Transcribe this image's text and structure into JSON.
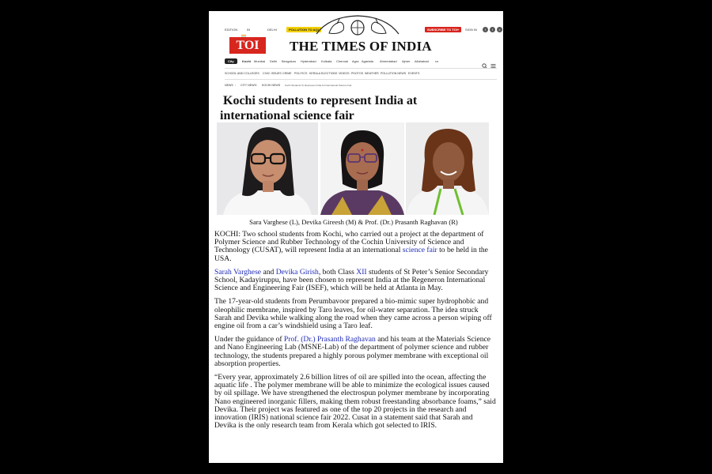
{
  "topbar": {
    "edition": "EDITION",
    "edition_code": "IN",
    "city": "DELHI",
    "pollution_button": "POLLUTION TO AQI",
    "subscribe_button": "SUBSCRIBE TO TOI+",
    "signin": "SIGN IN"
  },
  "masthead": {
    "logo": "TOI",
    "title": "THE TIMES OF INDIA"
  },
  "nav": {
    "city_pill": "City",
    "items": [
      "Kochi",
      "Mumbai",
      "Delhi",
      "Bengaluru",
      "Hyderabad",
      "Kolkata",
      "Chennai",
      "Agra",
      "Agartala",
      "Ahmedabad",
      "Ajmer",
      "Allahabad",
      "•••"
    ]
  },
  "subnav": {
    "items": [
      "SCHOOL AND COLLEGES",
      "CIVIC ISSUES",
      "CRIME",
      "POLITICS",
      "KERALA ELECTIONS",
      "VIDEOS",
      "PHOTOS",
      "WEATHER",
      "POLLUTION NEWS",
      "EVENTS"
    ]
  },
  "breadcrumb": [
    "NEWS",
    "CITY NEWS",
    "KOCHI NEWS",
    "Kochi Students To Represent India At International Science Fair"
  ],
  "article": {
    "headline_line1": "Kochi students to represent India at",
    "headline_line2": "international  science fair",
    "caption": "Sara Varghese (L), Devika Gireesh (M) & Prof. (Dr.) Prasanth Raghavan (R)",
    "p1_a": "KOCHI: Two school students from Kochi, who carried out a project at the department of Polymer Science and Rubber Technology of the Cochin University of Science and Technology (CUSAT), will represent India at an international ",
    "p1_link": "science fair",
    "p1_b": " to be held in the USA.",
    "p2_link1": "Sarah Varghese",
    "p2_and": " and ",
    "p2_link2": "Devika Girish",
    "p2_a": ", both Class ",
    "p2_link3": "XII",
    "p2_b": " students of St Peter’s Senior Secondary School, Kadayiruppu, have been chosen to represent India at the Regeneron International Science and Engineering Fair (ISEF), which will be held at Atlanta in May.",
    "p3": "The 17-year-old students from Perumbavoor prepared a bio-mimic super hydrophobic and oleophilic membrane, inspired by Taro leaves, for oil-water separation. The idea struck Sarah and Devika while walking along the road when they came across a person wiping off engine oil from a car’s windshield using a Taro leaf.",
    "p4_a": "Under the guidance of ",
    "p4_link": "Prof. (Dr.)  Prasanth Raghavan",
    "p4_b": " and his team at the Materials Science and Nano Engineering Lab (MSNE-Lab) of the department of polymer science and rubber technology, the students prepared a highly porous polymer membrane with exceptional oil absorption properties.",
    "p5": "“Every year, approximately 2.6 billion litres of oil are spilled into the ocean, affecting the aquatic life . The polymer membrane will be able to minimize the ecological issues caused by oil spillage. We have strengthened the electrospun polymer membrane by incorporating Nano engineered inorganic fillers, making them robust freestanding absorbance foams,” said Devika. Their project was featured as one of the top 20 projects in the research and innovation (IRIS) national science fair 2022. Cusat in a statement said that Sarah and Devika is the only research team from Kerala which got selected to IRIS."
  },
  "colors": {
    "brand_red": "#d7261e",
    "link_blue": "#1f2bb5",
    "pollution_yellow": "#f4d000"
  }
}
